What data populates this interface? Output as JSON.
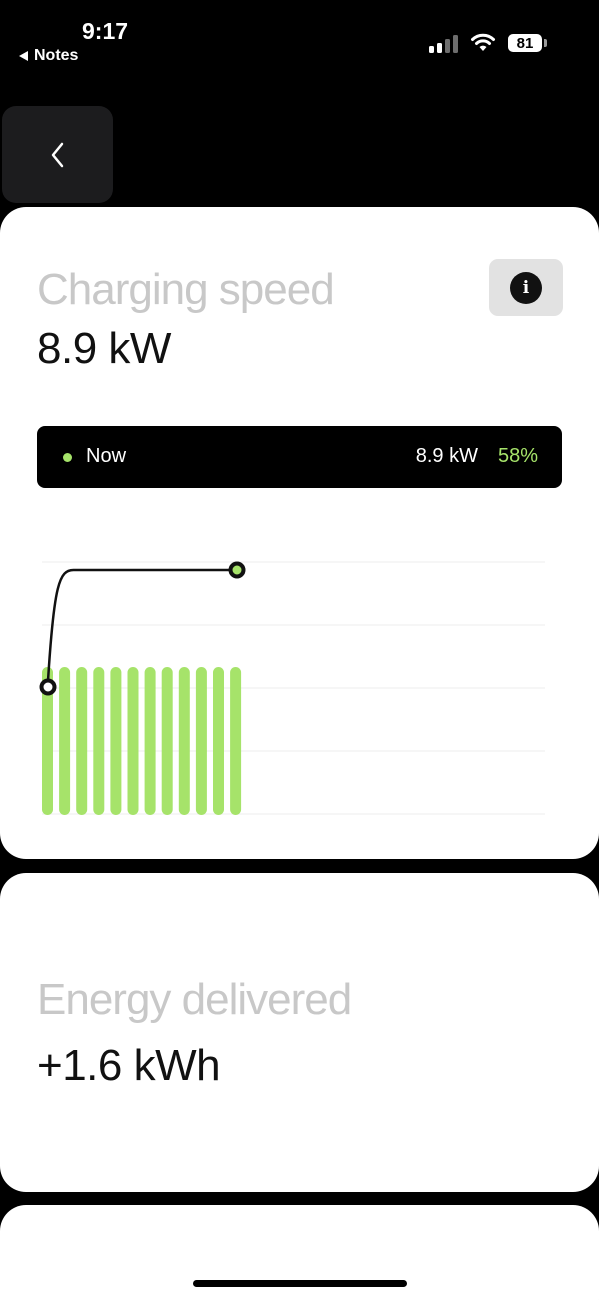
{
  "status_bar": {
    "time": "9:17",
    "back_app": "Notes",
    "battery": "81",
    "icons": [
      "signal-icon",
      "wifi-icon",
      "battery-icon"
    ]
  },
  "nav": {
    "back_icon": "chevron-left-icon"
  },
  "charging": {
    "title": "Charging speed",
    "value": "8.9 kW",
    "info_icon": "info-icon",
    "now": {
      "label": "Now",
      "power": "8.9 kW",
      "percent": "58%"
    }
  },
  "energy": {
    "title": "Energy delivered",
    "value": "+1.6 kWh"
  },
  "colors": {
    "accent": "#a6e36a",
    "card": "#ffffff",
    "background": "#000000",
    "muted_text": "#c8c8c8"
  },
  "chart_data": {
    "type": "bar",
    "title": "",
    "xlabel": "",
    "ylabel": "",
    "bar_count": 12,
    "bar_values": [
      1,
      1,
      1,
      1,
      1,
      1,
      1,
      1,
      1,
      1,
      1,
      1
    ],
    "line_points": [
      {
        "x": 0,
        "y": 0.72
      },
      {
        "x": 0.05,
        "y": 0.97
      },
      {
        "x": 1,
        "y": 0.97
      }
    ],
    "ylim": [
      0,
      1
    ],
    "grid": true
  }
}
